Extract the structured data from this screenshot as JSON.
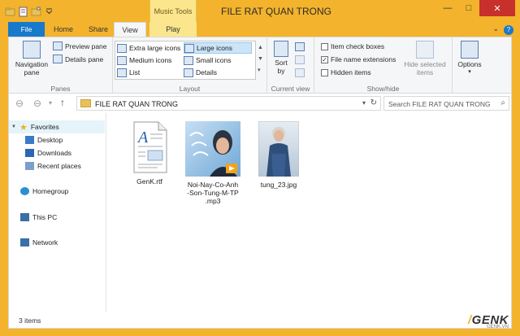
{
  "window": {
    "title": "FILE RAT QUAN TRONG",
    "context_header": "Music Tools",
    "accent": "#f3b32d",
    "file_tab_color": "#1979ca",
    "controls": {
      "minimize": "—",
      "maximize": "□",
      "close": "✕"
    }
  },
  "tabs": [
    {
      "label": "File"
    },
    {
      "label": "Home"
    },
    {
      "label": "Share"
    },
    {
      "label": "View"
    },
    {
      "label": "Play"
    }
  ],
  "ribbon": {
    "panes": {
      "label": "Panes",
      "navigation_pane": "Navigation\npane",
      "preview_pane": "Preview pane",
      "details_pane": "Details pane"
    },
    "layout": {
      "label": "Layout",
      "items": [
        "Extra large icons",
        "Large icons",
        "Medium icons",
        "Small icons",
        "List",
        "Details"
      ],
      "selected": "Large icons"
    },
    "current_view": {
      "label": "Current view",
      "sort_by": "Sort\nby"
    },
    "show_hide": {
      "label": "Show/hide",
      "item_check_boxes": "Item check boxes",
      "file_name_extensions": "File name extensions",
      "hidden_items": "Hidden items",
      "hide_selected_items": "Hide selected\nitems",
      "item_check_boxes_checked": false,
      "file_name_extensions_checked": true,
      "hidden_items_checked": false
    },
    "options": {
      "label": "Options"
    }
  },
  "address": {
    "path": "FILE RAT QUAN TRONG",
    "search_placeholder": "Search FILE RAT QUAN TRONG"
  },
  "nav_pane": {
    "favorites": "Favorites",
    "desktop": "Desktop",
    "downloads": "Downloads",
    "recent_places": "Recent places",
    "homegroup": "Homegroup",
    "this_pc": "This PC",
    "network": "Network"
  },
  "files": [
    {
      "name": "GenK.rtf",
      "icon": "rtf-document-icon"
    },
    {
      "name": "Noi-Nay-Co-Anh-Son-Tung-M-TP.mp3",
      "icon": "mp3-album-art-thumbnail"
    },
    {
      "name": "tung_23.jpg",
      "icon": "jpg-photo-thumbnail"
    }
  ],
  "file_labels": {
    "f1": "GenK.rtf",
    "f2a": "Noi-Nay-Co-Anh",
    "f2b": "-Son-Tung-M-TP",
    "f2c": ".mp3",
    "f3": "tung_23.jpg"
  },
  "status": {
    "items_count": "3 items"
  },
  "watermark": {
    "brand": "GENK",
    "sub": "GENK.VN"
  }
}
